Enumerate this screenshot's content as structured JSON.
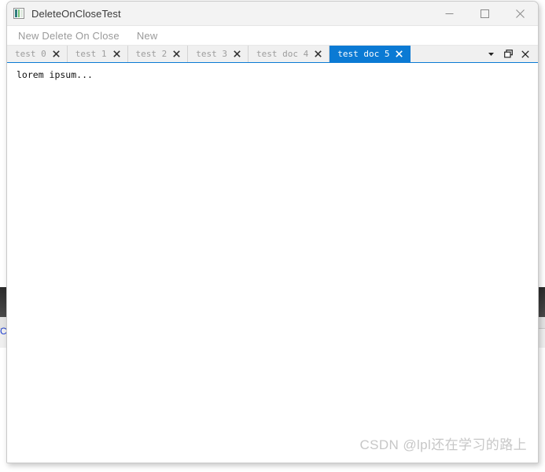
{
  "window": {
    "title": "DeleteOnCloseTest",
    "icon": "app-squares-icon",
    "controls": [
      {
        "name": "minimize",
        "glyph": "minimize-icon"
      },
      {
        "name": "maximize",
        "glyph": "maximize-icon"
      },
      {
        "name": "close",
        "glyph": "close-icon"
      }
    ]
  },
  "menu": {
    "items": [
      {
        "label": "New Delete On Close"
      },
      {
        "label": "New"
      }
    ]
  },
  "tabs": {
    "items": [
      {
        "label": "test 0",
        "active": false,
        "close_icon": "close-icon"
      },
      {
        "label": "test 1",
        "active": false,
        "close_icon": "close-icon"
      },
      {
        "label": "test 2",
        "active": false,
        "close_icon": "close-icon"
      },
      {
        "label": "test 3",
        "active": false,
        "close_icon": "close-icon"
      },
      {
        "label": "test doc 4",
        "active": false,
        "close_icon": "close-icon"
      },
      {
        "label": "test doc 5",
        "active": true,
        "close_icon": "close-icon"
      }
    ],
    "actions": [
      {
        "name": "tab-list-dropdown",
        "glyph": "chevron-down-icon"
      },
      {
        "name": "restore-document",
        "glyph": "restore-window-icon"
      },
      {
        "name": "close-document",
        "glyph": "close-icon"
      }
    ],
    "accent_color": "#0b7ad4",
    "inactive_label_color": "#9c9c9c"
  },
  "document": {
    "text": "lorem ipsum..."
  },
  "watermark": {
    "text": "CSDN @lpl还在学习的路上"
  },
  "background": {
    "letter": "C"
  }
}
